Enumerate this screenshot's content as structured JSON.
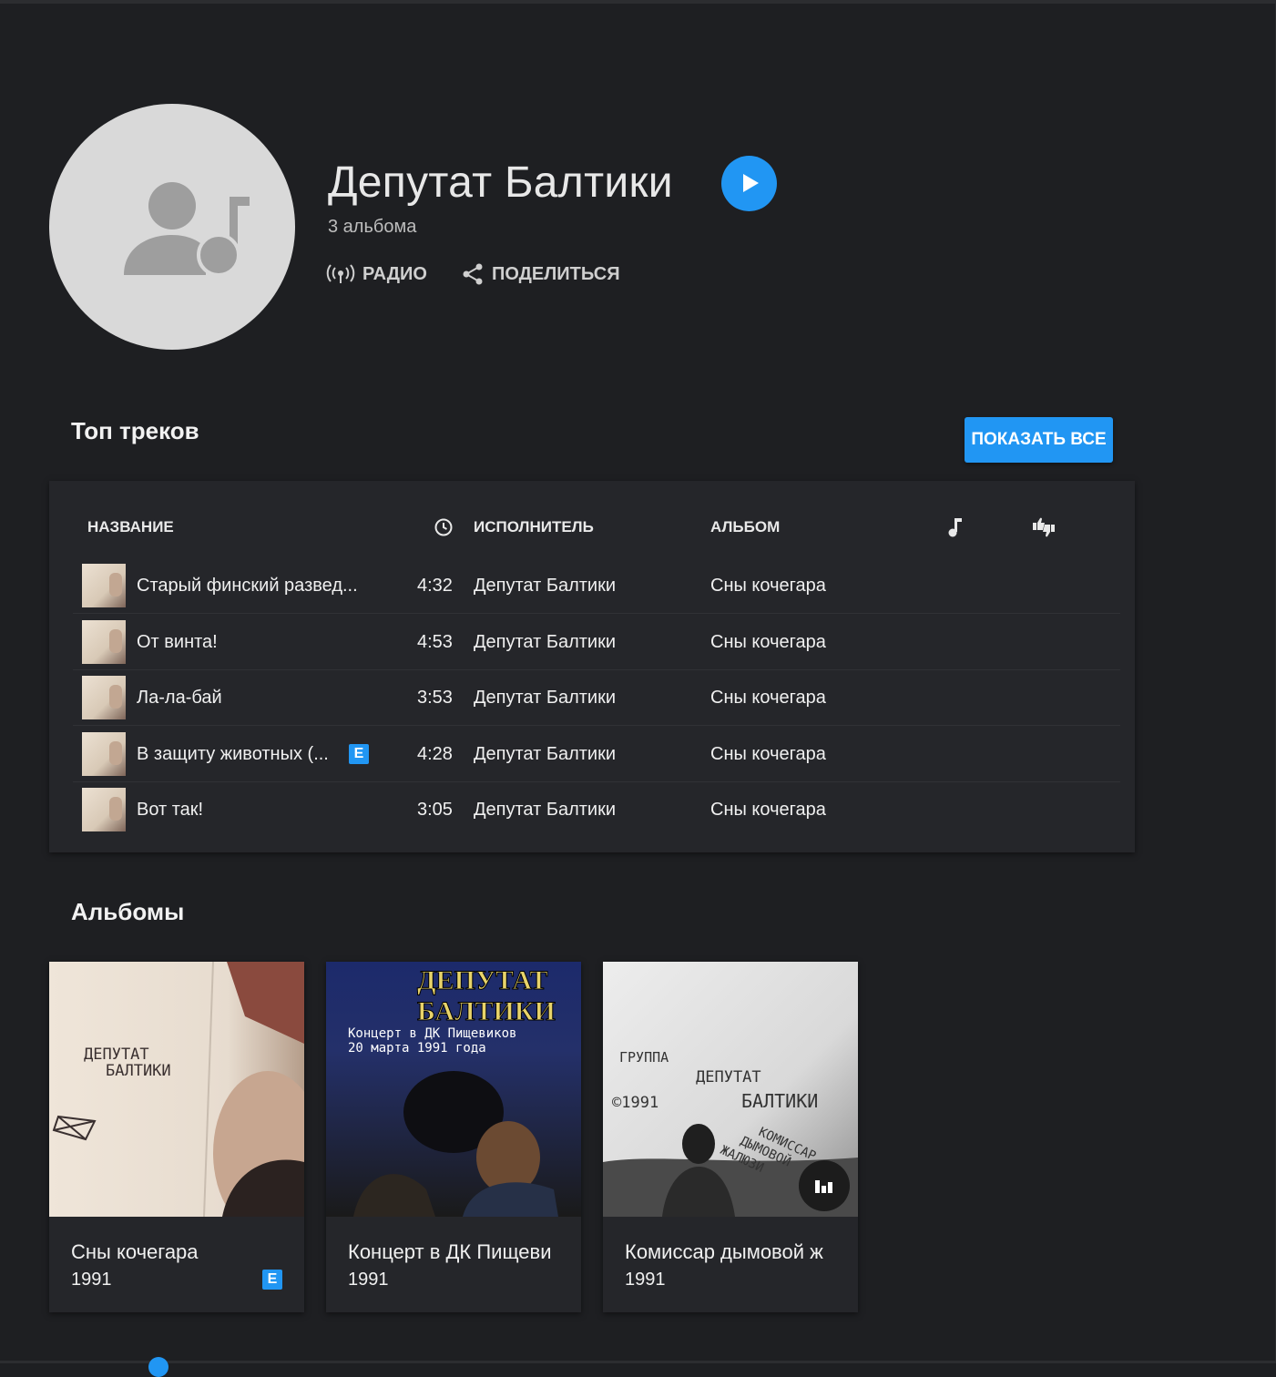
{
  "artist": {
    "name": "Депутат Балтики",
    "albums_count": "3 альбома",
    "radio_label": "РАДИО",
    "share_label": "ПОДЕЛИТЬСЯ"
  },
  "top_tracks": {
    "title": "Топ треков",
    "show_all_label": "ПОКАЗАТЬ ВСЕ",
    "columns": {
      "name": "НАЗВАНИЕ",
      "artist": "ИСПОЛНИТЕЛЬ",
      "album": "АЛЬБОМ"
    },
    "rows": [
      {
        "title": "Старый финский развед...",
        "duration": "4:32",
        "artist": "Депутат Балтики",
        "album": "Сны кочегара",
        "explicit": false
      },
      {
        "title": "От винта!",
        "duration": "4:53",
        "artist": "Депутат Балтики",
        "album": "Сны кочегара",
        "explicit": false
      },
      {
        "title": "Ла-ла-бай",
        "duration": "3:53",
        "artist": "Депутат Балтики",
        "album": "Сны кочегара",
        "explicit": false
      },
      {
        "title": "В защиту животных (...",
        "duration": "4:28",
        "artist": "Депутат Балтики",
        "album": "Сны кочегара",
        "explicit": true
      },
      {
        "title": "Вот так!",
        "duration": "3:05",
        "artist": "Депутат Балтики",
        "album": "Сны кочегара",
        "explicit": false
      }
    ]
  },
  "albums": {
    "title": "Альбомы",
    "items": [
      {
        "name": "Сны кочегара",
        "year": "1991",
        "explicit": true,
        "cover_text": [
          "ДЕПУТАТ",
          "БАЛТИКИ"
        ]
      },
      {
        "name": "Концерт в ДК Пищеви",
        "year": "1991",
        "explicit": false,
        "cover_text": [
          "ДЕПУТАТ",
          "БАЛТИКИ",
          "Концерт в ДК Пищевиков",
          "20 марта 1991 года"
        ]
      },
      {
        "name": "Комиссар дымовой ж",
        "year": "1991",
        "explicit": false,
        "cover_text": [
          "ГРУППА",
          "ДЕПУТАТ",
          "БАЛТИКИ",
          "©1991",
          "КОМИССАР",
          "ДЫМОВОЙ",
          "ЖАЛЮЗИ"
        ]
      }
    ]
  },
  "explicit_badge": "E",
  "colors": {
    "accent": "#2196f3",
    "background": "#1e1f22",
    "card": "#25262a"
  }
}
